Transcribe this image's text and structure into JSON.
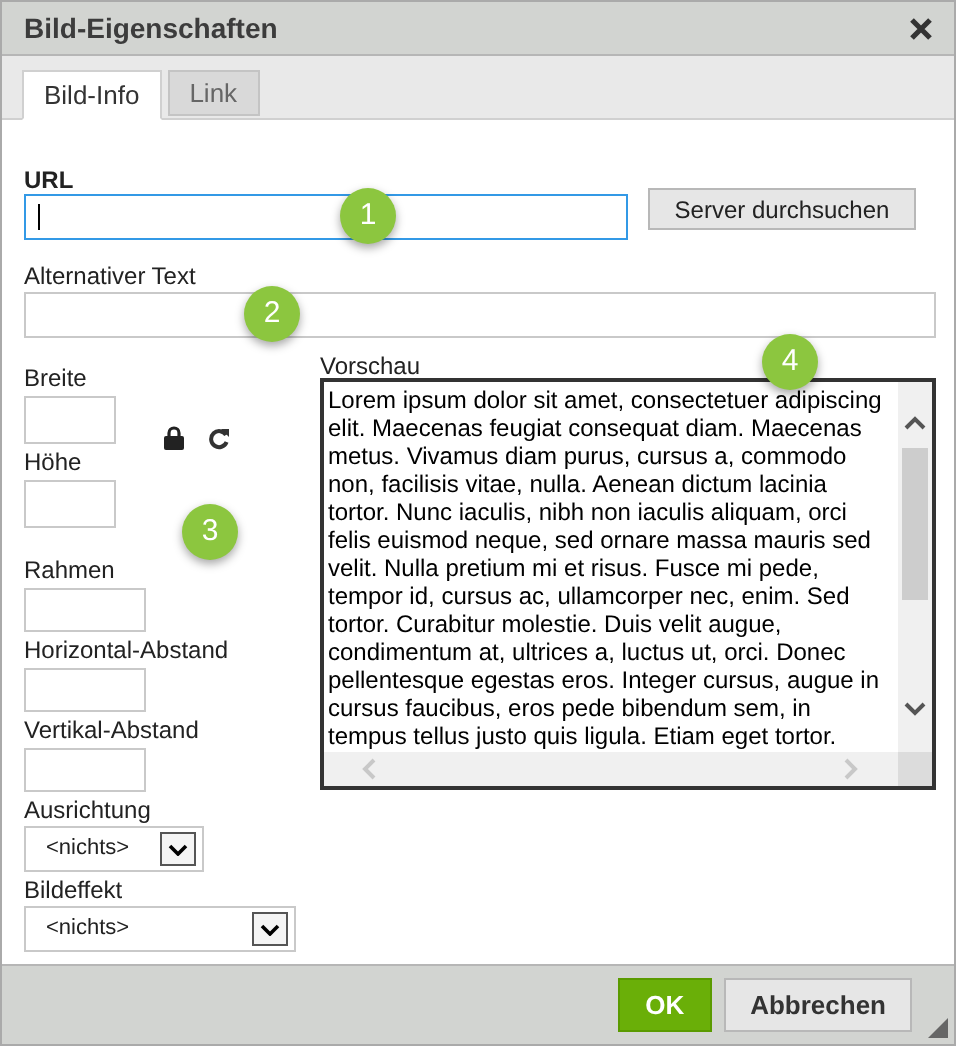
{
  "dialog": {
    "title": "Bild-Eigenschaften"
  },
  "tabs": [
    {
      "label": "Bild-Info",
      "selected": true
    },
    {
      "label": "Link",
      "selected": false
    }
  ],
  "url": {
    "label": "URL",
    "focused": true
  },
  "browse_button": "Server durchsuchen",
  "alt_text": {
    "label": "Alternativer Text",
    "focused": false
  },
  "size_fields": [
    {
      "label": "Breite"
    },
    {
      "label": "Höhe"
    }
  ],
  "spacing_fields": [
    {
      "label": "Rahmen"
    },
    {
      "label": "Horizontal-Abstand"
    },
    {
      "label": "Vertikal-Abstand"
    }
  ],
  "selects": [
    {
      "label": "Ausrichtung",
      "value": "<nichts>"
    },
    {
      "label": "Bildeffekt",
      "value": "<nichts>"
    }
  ],
  "preview": {
    "label": "Vorschau",
    "text": "Lorem ipsum dolor sit amet, consectetuer adipiscing elit. Maecenas feugiat consequat diam. Maecenas metus. Vivamus diam purus, cursus a, commodo non, facilisis vitae, nulla. Aenean dictum lacinia tortor. Nunc iaculis, nibh non iaculis aliquam, orci felis euismod neque, sed ornare massa mauris sed velit. Nulla pretium mi et risus. Fusce mi pede, tempor id, cursus ac, ullamcorper nec, enim. Sed tortor. Curabitur molestie. Duis velit augue, condimentum at, ultrices a, luctus ut, orci. Donec pellentesque egestas eros. Integer cursus, augue in cursus faucibus, eros pede bibendum sem, in tempus tellus justo quis ligula. Etiam eget tortor."
  },
  "buttons": [
    {
      "label": "OK",
      "kind": "primary"
    },
    {
      "label": "Abbrechen",
      "kind": "secondary"
    }
  ],
  "markers": [
    "1",
    "2",
    "3",
    "4"
  ]
}
